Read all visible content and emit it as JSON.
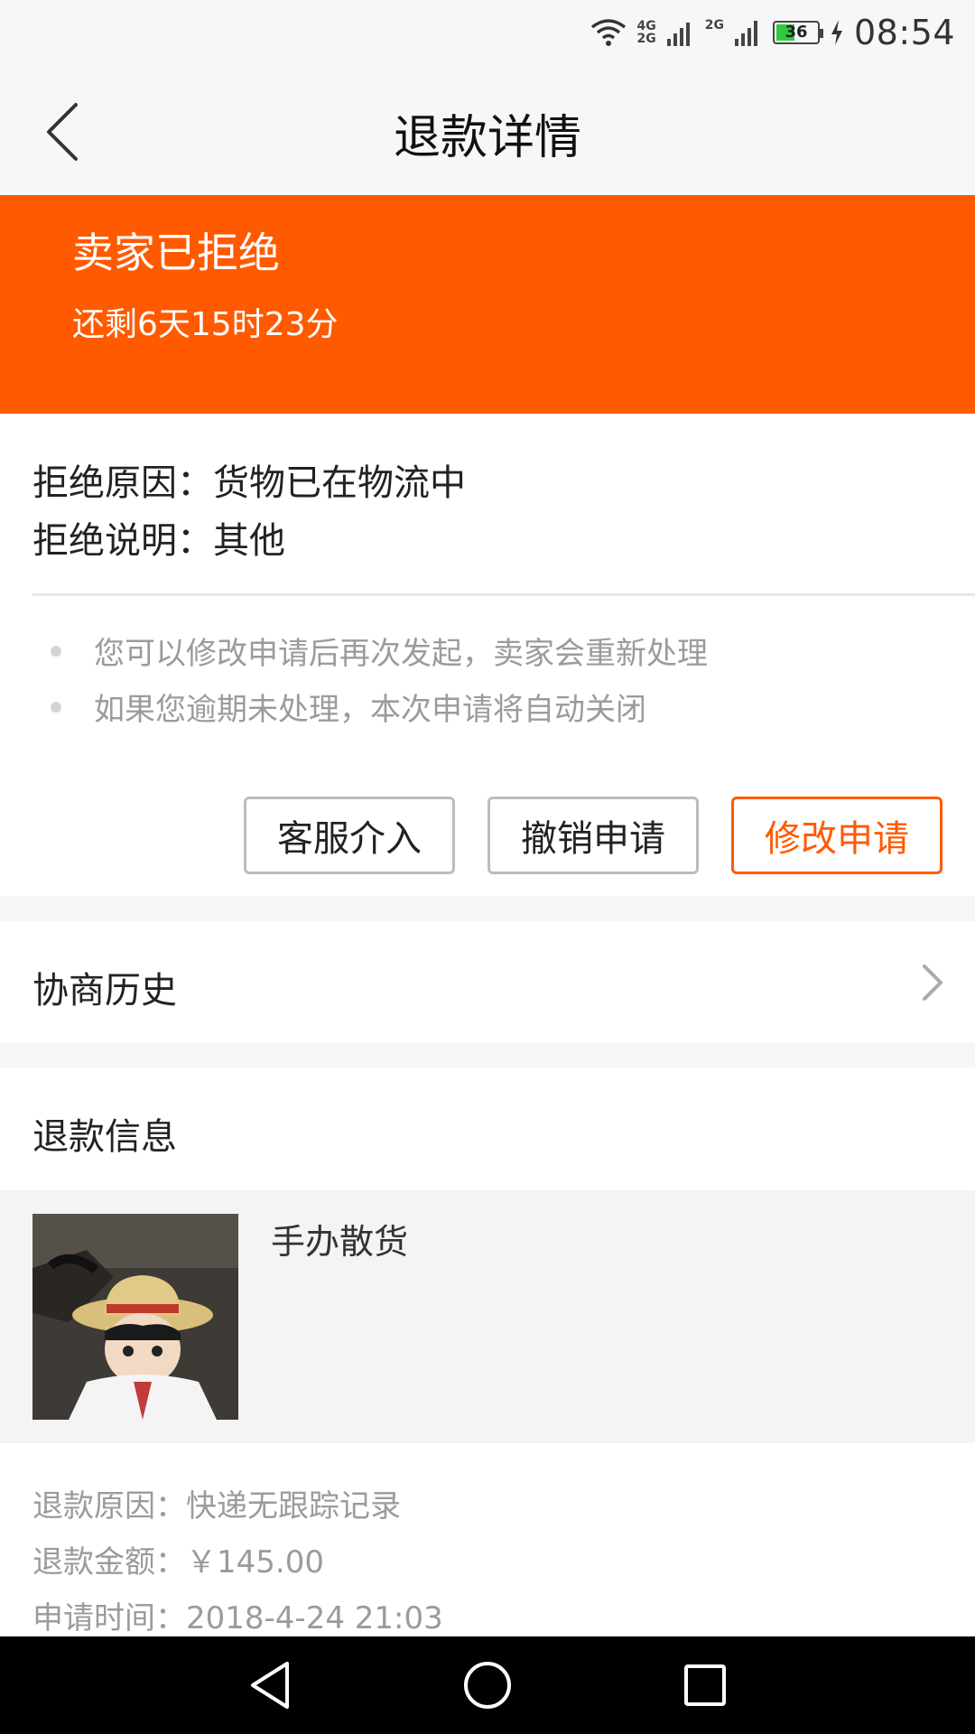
{
  "status_bar": {
    "network_top": "4G",
    "network_bottom": "2G",
    "network_2": "2G",
    "battery_level": "36",
    "time": "08:54"
  },
  "header": {
    "title": "退款详情"
  },
  "banner": {
    "status": "卖家已拒绝",
    "countdown": "还剩6天15时23分",
    "color": "#ff5a00"
  },
  "rejection": {
    "reason_label": "拒绝原因：",
    "reason_value": "货物已在物流中",
    "note_label": "拒绝说明：",
    "note_value": "其他"
  },
  "tips": [
    "您可以修改申请后再次发起，卖家会重新处理",
    "如果您逾期未处理，本次申请将自动关闭"
  ],
  "actions": {
    "customer_service": "客服介入",
    "cancel": "撤销申请",
    "modify": "修改申请"
  },
  "history": {
    "label": "协商历史"
  },
  "refund_info": {
    "title": "退款信息",
    "product_name": "手办散货",
    "reason_label": "退款原因：",
    "reason_value": "快递无跟踪记录",
    "amount_label": "退款金额：",
    "amount_value": "￥145.00",
    "time_label": "申请时间：",
    "time_value": "2018-4-24 21:03"
  },
  "icons": {
    "back": "back-arrow-icon",
    "chevron": "chevron-right-icon",
    "wifi": "wifi-icon",
    "signal": "signal-icon",
    "battery": "battery-icon",
    "charging": "charging-icon"
  }
}
